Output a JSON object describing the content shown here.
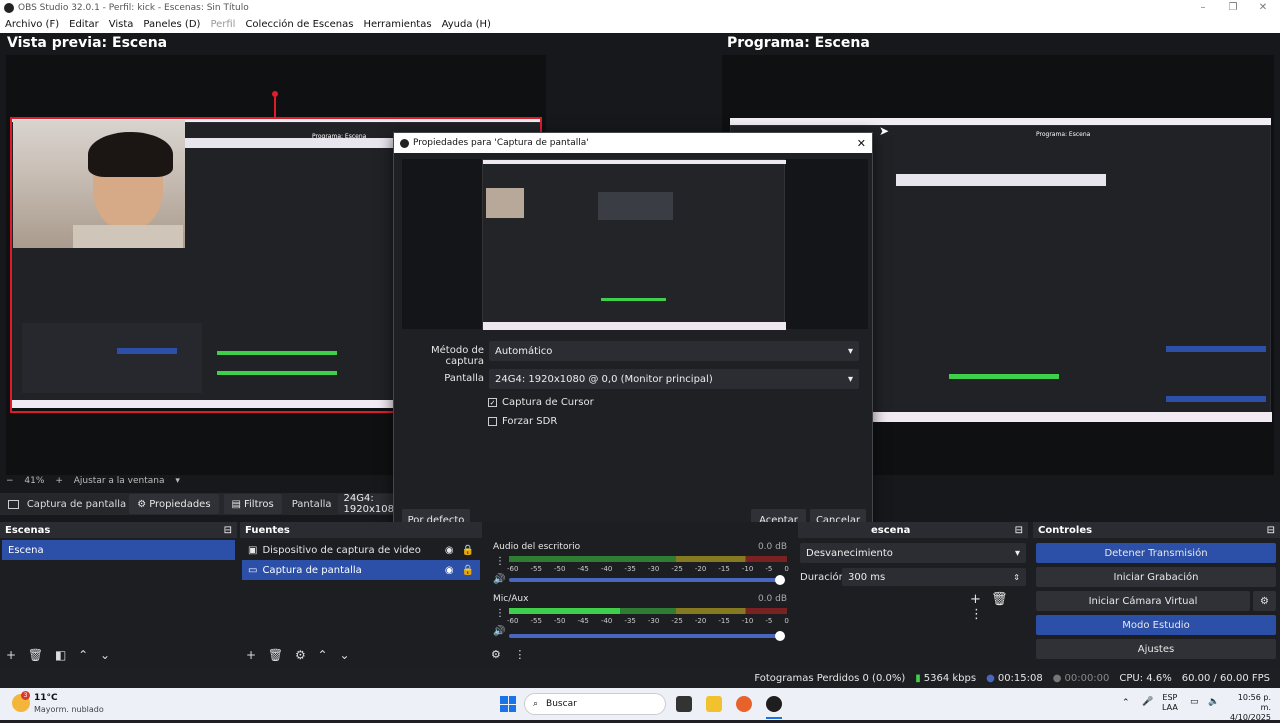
{
  "window": {
    "title": "OBS Studio 32.0.1 - Perfil: kick - Escenas: Sin Título"
  },
  "menu": [
    "Archivo (F)",
    "Editar",
    "Vista",
    "Paneles (D)",
    "Perfil",
    "Colección de Escenas",
    "Herramientas",
    "Ayuda (H)"
  ],
  "preview": {
    "title": "Vista previa: Escena",
    "zoom": "41%",
    "fit": "Ajustar a la ventana"
  },
  "program": {
    "title": "Programa: Escena"
  },
  "source_toolbar": {
    "source": "Captura de pantalla",
    "properties": "Propiedades",
    "filters": "Filtros",
    "display_label": "Pantalla",
    "display_value": "24G4: 1920x108"
  },
  "dialog": {
    "title": "Propiedades para 'Captura de pantalla'",
    "method_label": "Método de captura",
    "method_value": "Automático",
    "display_label": "Pantalla",
    "display_value": "24G4: 1920x1080 @ 0,0 (Monitor principal)",
    "cursor_label": "Captura de Cursor",
    "sdr_label": "Forzar SDR",
    "default_btn": "Por defecto",
    "accept_btn": "Aceptar",
    "cancel_btn": "Cancelar"
  },
  "scenes": {
    "title": "Escenas",
    "items": [
      "Escena"
    ]
  },
  "sources": {
    "title": "Fuentes",
    "items": [
      "Dispositivo de captura de video",
      "Captura de pantalla"
    ]
  },
  "mixer": {
    "channels": [
      {
        "name": "Audio del escritorio",
        "db": "0.0 dB"
      },
      {
        "name": "Mic/Aux",
        "db": "0.0 dB"
      }
    ],
    "scale": [
      "-60",
      "-55",
      "-50",
      "-45",
      "-40",
      "-35",
      "-30",
      "-25",
      "-20",
      "-15",
      "-10",
      "-5",
      "0"
    ]
  },
  "transitions": {
    "title": "escena",
    "type": "Desvanecimiento",
    "duration_label": "Duración",
    "duration_value": "300 ms"
  },
  "controls": {
    "title": "Controles",
    "buttons": [
      "Detener Transmisión",
      "Iniciar Grabación",
      "Iniciar Cámara Virtual",
      "Modo Estudio",
      "Ajustes"
    ]
  },
  "status": {
    "dropped": "Fotogramas Perdidos 0 (0.0%)",
    "bitrate": "5364 kbps",
    "stream_time": "00:15:08",
    "rec_time": "00:00:00",
    "cpu": "CPU: 4.6%",
    "fps": "60.00 / 60.00 FPS"
  },
  "taskbar": {
    "weather_temp": "11°C",
    "weather_desc": "Mayorm. nublado",
    "search": "Buscar",
    "lang1": "ESP",
    "lang2": "LAA",
    "time": "10:56 p. m.",
    "date": "4/10/2025",
    "badge": "3"
  },
  "colors": {
    "accent": "#2c4fa8",
    "red": "#e01c2b"
  }
}
